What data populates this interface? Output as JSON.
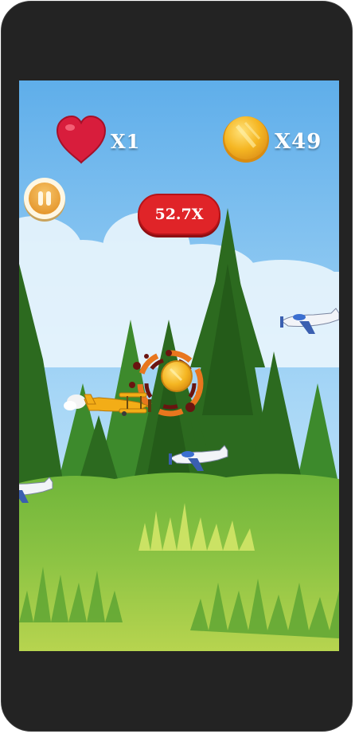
{
  "hud": {
    "lives_text": "X1",
    "coins_text": "X49",
    "multiplier_text": "52.7X"
  },
  "icons": {
    "lives": "heart-icon",
    "coins": "coin-icon",
    "pause": "pause-icon"
  },
  "colors": {
    "heart": "#d81d3c",
    "coin": "#f2b01e",
    "multiplier_badge": "#e02428",
    "pause_button": "#e08a1c",
    "sky": "#8fc8f1",
    "grass": "#7dbb3a",
    "trees": "#2f6b22"
  },
  "game_objects": {
    "player": "yellow-biplane",
    "enemies": [
      "enemy-plane-right",
      "enemy-plane-middle",
      "enemy-plane-left"
    ],
    "collectible": "coin",
    "effect": "explosion-splatter"
  }
}
